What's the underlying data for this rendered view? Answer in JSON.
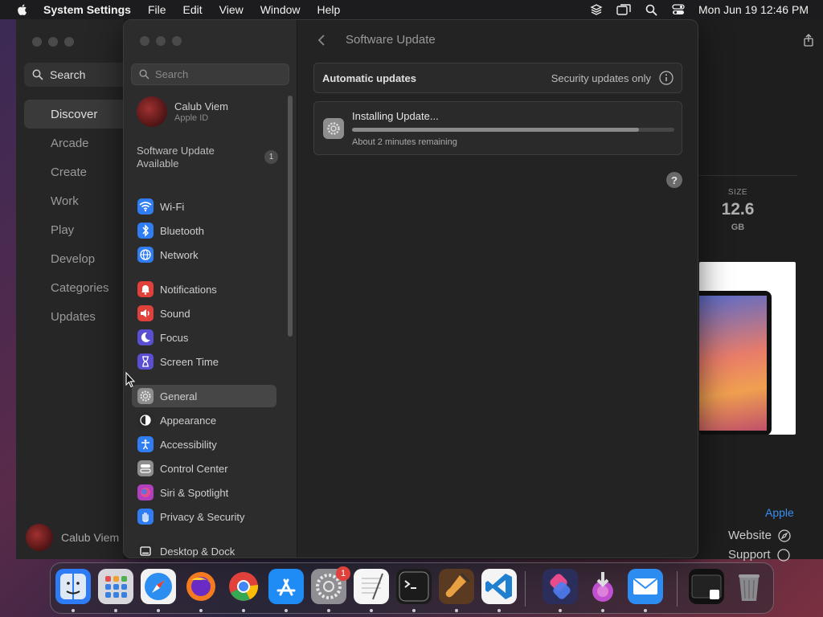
{
  "menubar": {
    "app_name": "System Settings",
    "items": [
      "File",
      "Edit",
      "View",
      "Window",
      "Help"
    ],
    "clock": "Mon Jun 19  12:46 PM"
  },
  "appstore": {
    "search_label": "Search",
    "nav": [
      "Discover",
      "Arcade",
      "Create",
      "Work",
      "Play",
      "Develop",
      "Categories",
      "Updates"
    ],
    "selected_nav": "Discover",
    "user_name": "Calub Viem",
    "size_label": "SIZE",
    "size_value": "12.6",
    "size_unit": "GB",
    "developer_link": "Apple",
    "website_label": "Website",
    "support_label": "Support"
  },
  "settings": {
    "search_placeholder": "Search",
    "user_name": "Calub Viem",
    "user_sub": "Apple ID",
    "update_notice_line1": "Software Update",
    "update_notice_line2": "Available",
    "update_badge": "1",
    "sidebar": [
      {
        "label": "Wi-Fi",
        "icon": "wifi-icon",
        "color": "#2f7df0"
      },
      {
        "label": "Bluetooth",
        "icon": "bluetooth-icon",
        "color": "#2f7df0"
      },
      {
        "label": "Network",
        "icon": "globe-icon",
        "color": "#2f7df0"
      },
      {
        "label": "Notifications",
        "icon": "bell-icon",
        "color": "#e0413a"
      },
      {
        "label": "Sound",
        "icon": "speaker-icon",
        "color": "#e0413a"
      },
      {
        "label": "Focus",
        "icon": "moon-icon",
        "color": "#5a4fd0"
      },
      {
        "label": "Screen Time",
        "icon": "hourglass-icon",
        "color": "#5a4fd0"
      },
      {
        "label": "General",
        "icon": "gear-icon",
        "color": "#8e8e8e"
      },
      {
        "label": "Appearance",
        "icon": "appearance-icon",
        "color": "#2a2a2a"
      },
      {
        "label": "Accessibility",
        "icon": "accessibility-icon",
        "color": "#2f7df0"
      },
      {
        "label": "Control Center",
        "icon": "control-center-icon",
        "color": "#8e8e8e"
      },
      {
        "label": "Siri & Spotlight",
        "icon": "siri-icon",
        "color": "#b040c0"
      },
      {
        "label": "Privacy & Security",
        "icon": "hand-icon",
        "color": "#2f7df0"
      },
      {
        "label": "Desktop & Dock",
        "icon": "dock-icon",
        "color": "#2a2a2a"
      }
    ],
    "selected": "General",
    "page_title": "Software Update",
    "auto_updates_label": "Automatic updates",
    "auto_updates_value": "Security updates only",
    "install_title": "Installing Update...",
    "install_progress": 0.89,
    "install_remaining": "About 2 minutes remaining",
    "help_label": "?"
  },
  "dock": {
    "apps": [
      "finder-icon",
      "launchpad-icon",
      "safari-icon",
      "firefox-icon",
      "chrome-icon",
      "app-store-icon",
      "system-settings-icon",
      "textedit-icon",
      "terminal-icon",
      "garageband-icon",
      "vscode-icon",
      "shortcuts-icon",
      "installer-icon",
      "mail-icon",
      "screenshot-icon",
      "trash-icon"
    ],
    "settings_badge": "1"
  }
}
